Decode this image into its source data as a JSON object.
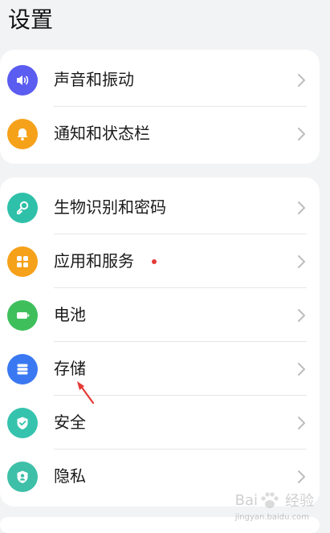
{
  "header": {
    "title": "设置"
  },
  "group1": {
    "items": [
      {
        "label": "声音和振动",
        "icon": "speaker-icon",
        "color": "#5b5cf0"
      },
      {
        "label": "通知和状态栏",
        "icon": "bell-icon",
        "color": "#f5a11a"
      }
    ]
  },
  "group2": {
    "items": [
      {
        "label": "生物识别和密码",
        "icon": "key-icon",
        "color": "#2fc0a9"
      },
      {
        "label": "应用和服务",
        "icon": "apps-icon",
        "color": "#f5a11a",
        "badge": true
      },
      {
        "label": "电池",
        "icon": "battery-icon",
        "color": "#3fbf5c"
      },
      {
        "label": "存储",
        "icon": "storage-icon",
        "color": "#3a78f2"
      },
      {
        "label": "安全",
        "icon": "shield-icon",
        "color": "#36c3ae"
      },
      {
        "label": "隐私",
        "icon": "privacy-icon",
        "color": "#3ebfa8"
      }
    ]
  },
  "colors": {
    "badge": "#e53935",
    "annotation": "#e53935",
    "chevron": "#bdbdbd"
  },
  "watermark": {
    "brand": "Bai",
    "suffix": "经验",
    "domain": "jingyan.baidu.com"
  }
}
